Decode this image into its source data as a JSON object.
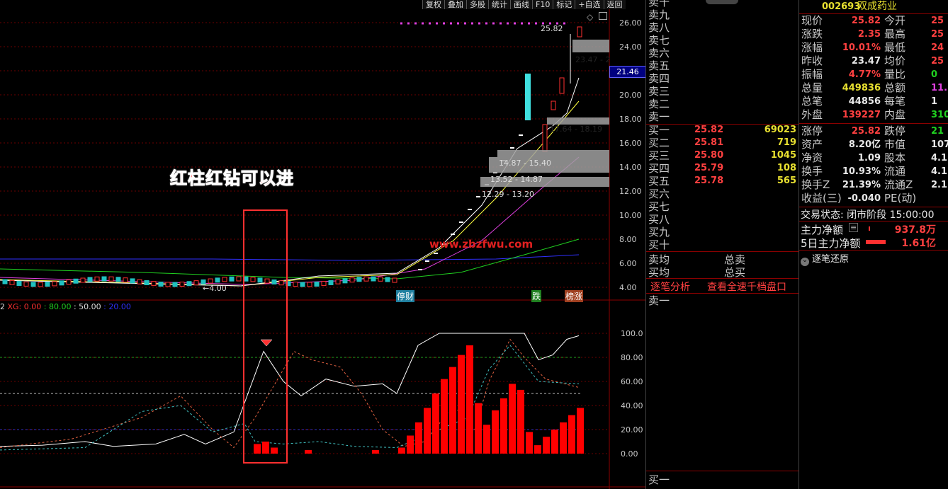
{
  "toolbar": [
    "复权",
    "叠加",
    "多股",
    "统计",
    "画线",
    "F10",
    "标记",
    "+自选",
    "返回"
  ],
  "stock": {
    "code": "002693",
    "name": "双成药业"
  },
  "price_axis": [
    "26.00",
    "24.00",
    "22.00",
    "20.00",
    "18.00",
    "16.00",
    "14.00",
    "12.00",
    "10.00",
    "8.00",
    "6.00",
    "4.00"
  ],
  "indicator_axis": [
    "100.0",
    "80.00",
    "60.00",
    "40.00",
    "20.00",
    "0.00"
  ],
  "chart_labels": {
    "current_price_tag": "21.46",
    "high_label": "25.82",
    "zone1": "23.47 - 2",
    "zone2": "17.64 - 18.19",
    "zone3": "14.87 - 15.40",
    "zone4": "13.52 - 14.87",
    "zone5": "12.29 - 13.20",
    "low_label": "4.00",
    "annotation": "红柱红钻可以进",
    "watermark": "www.zbzfwu.com",
    "tag_stop": "停财",
    "tag_down": "跌",
    "tag_rank": "榜涨",
    "indicator_header": {
      "xg": "XG: 0.00",
      "v80": ": 80.00",
      "v50": ": 50.00",
      "v20": ": 20.00",
      "prefix": "2"
    }
  },
  "orderbook": {
    "sell": [
      "卖十",
      "卖九",
      "卖八",
      "卖七",
      "卖六",
      "卖五",
      "卖四",
      "卖三",
      "卖二",
      "卖一"
    ],
    "buy": [
      {
        "label": "买一",
        "price": "25.82",
        "vol": "69023"
      },
      {
        "label": "买二",
        "price": "25.81",
        "vol": "719"
      },
      {
        "label": "买三",
        "price": "25.80",
        "vol": "1045"
      },
      {
        "label": "买四",
        "price": "25.79",
        "vol": "108"
      },
      {
        "label": "买五",
        "price": "25.78",
        "vol": "565"
      },
      {
        "label": "买六",
        "price": "",
        "vol": ""
      },
      {
        "label": "买七",
        "price": "",
        "vol": ""
      },
      {
        "label": "买八",
        "price": "",
        "vol": ""
      },
      {
        "label": "买九",
        "price": "",
        "vol": ""
      },
      {
        "label": "买十",
        "price": "",
        "vol": ""
      }
    ],
    "avg_sell": "卖均",
    "total_sell": "总卖",
    "avg_buy": "买均",
    "total_buy": "总买",
    "tab1": "逐笔分析",
    "tab2": "查看全速千档盘口",
    "sell1_bottom": "卖一",
    "buy1_bottom": "买一"
  },
  "quote": {
    "rows": [
      {
        "l": "现价",
        "v": "25.82",
        "vc": "red",
        "l2": "今开",
        "v2": "25",
        "v2c": "red"
      },
      {
        "l": "涨跌",
        "v": "2.35",
        "vc": "red",
        "l2": "最高",
        "v2": "25",
        "v2c": "red"
      },
      {
        "l": "涨幅",
        "v": "10.01%",
        "vc": "red",
        "l2": "最低",
        "v2": "24",
        "v2c": "red"
      },
      {
        "l": "昨收",
        "v": "23.47",
        "vc": "white",
        "l2": "均价",
        "v2": "25",
        "v2c": "red"
      },
      {
        "l": "振幅",
        "v": "4.77%",
        "vc": "red",
        "l2": "量比",
        "v2": "0",
        "v2c": "green"
      },
      {
        "l": "总量",
        "v": "449836",
        "vc": "yellow",
        "l2": "总额",
        "v2": "11.",
        "v2c": "magenta"
      },
      {
        "l": "总笔",
        "v": "44856",
        "vc": "white",
        "l2": "每笔",
        "v2": "1",
        "v2c": "white"
      },
      {
        "l": "外盘",
        "v": "139227",
        "vc": "red",
        "l2": "内盘",
        "v2": "310",
        "v2c": "green"
      }
    ],
    "rows2": [
      {
        "l": "涨停",
        "v": "25.82",
        "vc": "red",
        "l2": "跌停",
        "v2": "21",
        "v2c": "green"
      },
      {
        "l": "资产",
        "v": "8.20亿",
        "vc": "white",
        "l2": "市值",
        "v2": "107.",
        "v2c": "white"
      },
      {
        "l": "净资",
        "v": "1.09",
        "vc": "white",
        "l2": "股本",
        "v2": "4.1",
        "v2c": "white"
      },
      {
        "l": "换手",
        "v": "10.93%",
        "vc": "white",
        "l2": "流通",
        "v2": "4.1",
        "v2c": "white"
      },
      {
        "l": "换手Z",
        "v": "21.39%",
        "vc": "white",
        "l2": "流通Z",
        "v2": "2.1",
        "v2c": "white"
      },
      {
        "l": "收益(三)",
        "v": "-0.040",
        "vc": "white",
        "l2": "PE(动)",
        "v2": "",
        "v2c": "white"
      }
    ],
    "trade_status": "交易状态: 闭市阶段 15:00:00",
    "main_net_label": "主力净额",
    "main_net_value": "937.8万",
    "five_day_label": "5日主力净额",
    "five_day_value": "1.61亿",
    "tick_restore": "逐笔还原"
  },
  "colors": {
    "up": "#ff3030",
    "down": "#20c0c0",
    "grid": "#8b0000",
    "ma5": "#ffffff",
    "ma10": "#ffff40",
    "ma20": "#e040e0",
    "ma60": "#20d020",
    "ma120": "#3030ff"
  }
}
